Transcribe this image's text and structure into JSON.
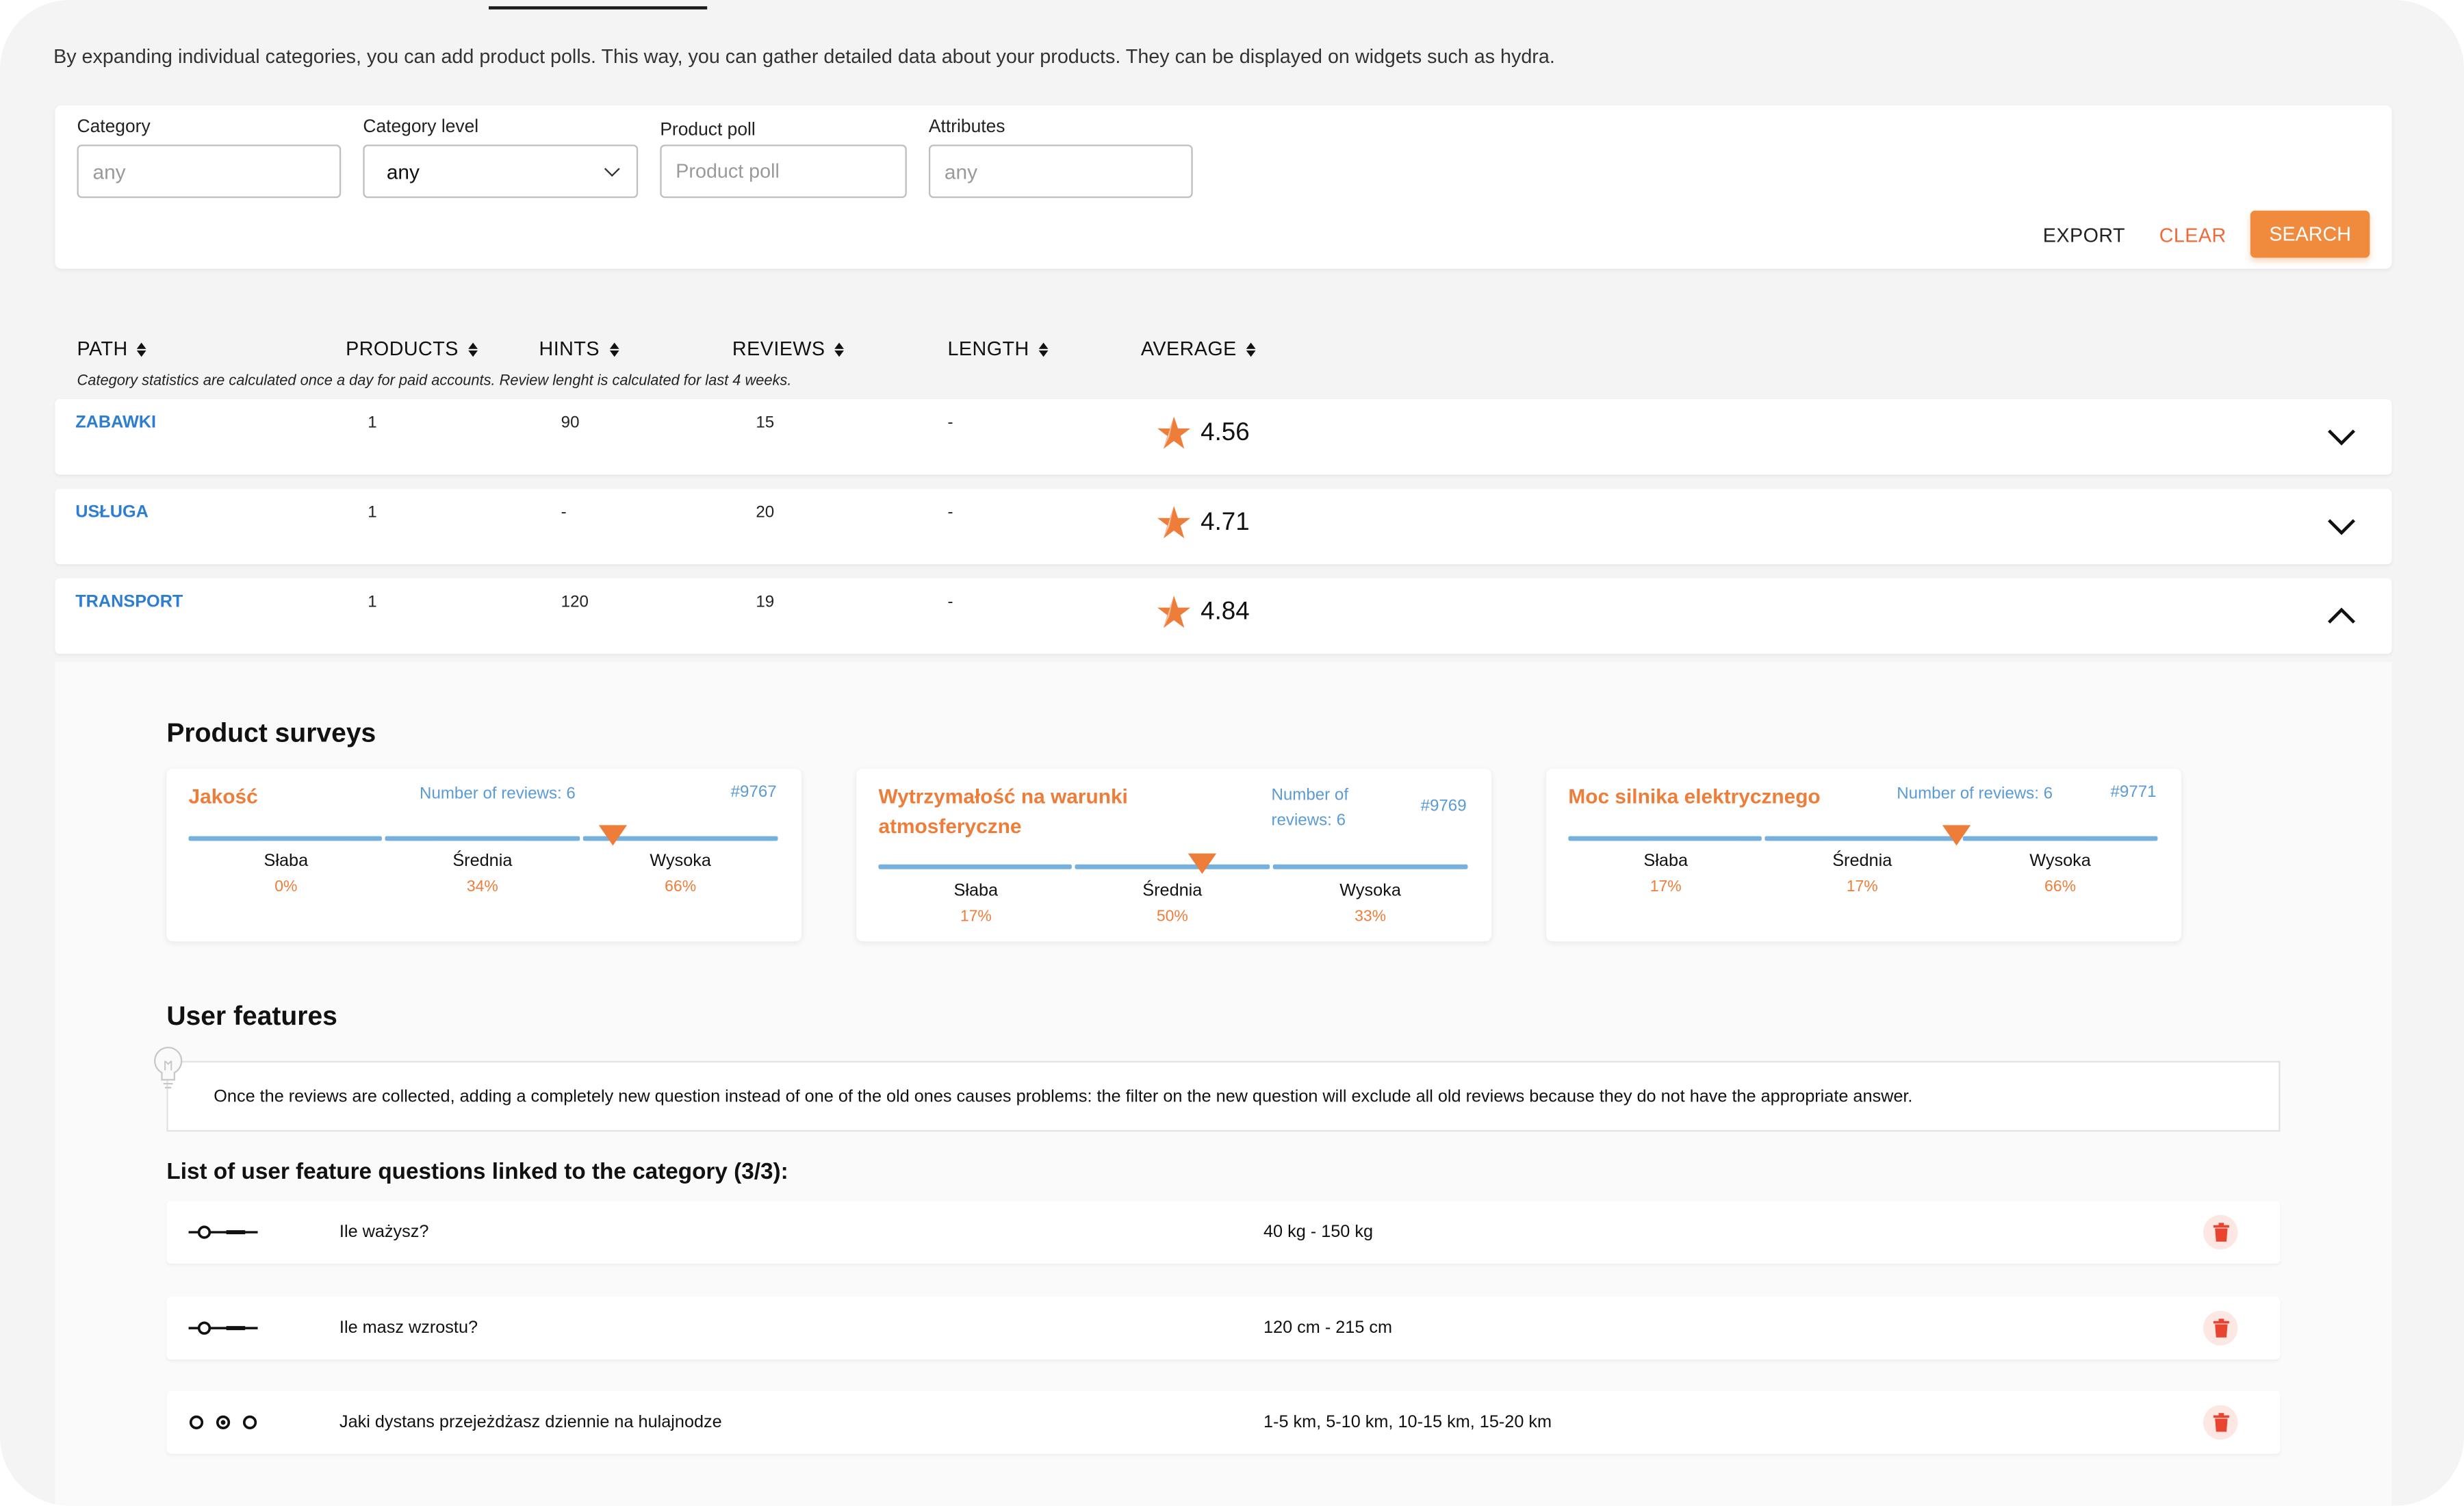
{
  "intro": "By expanding individual categories, you can add product polls. This way, you can gather detailed data about your products. They can be displayed on widgets such as hydra.",
  "filters": {
    "category": {
      "label": "Category",
      "placeholder": "any"
    },
    "category_level": {
      "label": "Category level",
      "value": "any"
    },
    "product_poll": {
      "label": "Product poll",
      "placeholder": "Product poll"
    },
    "attributes": {
      "label": "Attributes",
      "placeholder": "any"
    },
    "export_label": "EXPORT",
    "clear_label": "CLEAR",
    "search_label": "SEARCH"
  },
  "table": {
    "headers": [
      "PATH",
      "PRODUCTS",
      "HINTS",
      "REVIEWS",
      "LENGTH",
      "AVERAGE"
    ],
    "note": "Category statistics are calculated once a day for paid accounts. Review lenght is calculated for last 4 weeks.",
    "rows": [
      {
        "path": "ZABAWKI",
        "products": "1",
        "hints": "90",
        "reviews": "15",
        "length": "-",
        "average": "4.56",
        "expanded": false
      },
      {
        "path": "USŁUGA",
        "products": "1",
        "hints": "-",
        "reviews": "20",
        "length": "-",
        "average": "4.71",
        "expanded": false
      },
      {
        "path": "TRANSPORT",
        "products": "1",
        "hints": "120",
        "reviews": "19",
        "length": "-",
        "average": "4.84",
        "expanded": true
      }
    ]
  },
  "surveys_title": "Product surveys",
  "surveys": [
    {
      "title": "Jakość",
      "count": "Number of reviews: 6",
      "id": "#9767",
      "options": [
        {
          "label": "Słaba",
          "pct": "0%"
        },
        {
          "label": "Średnia",
          "pct": "34%"
        },
        {
          "label": "Wysoka",
          "pct": "66%"
        }
      ],
      "marker_value": 0.72
    },
    {
      "title": "Wytrzymałość na warunki atmosferyczne",
      "count": "Number of reviews: 6",
      "id": "#9769",
      "options": [
        {
          "label": "Słaba",
          "pct": "17%"
        },
        {
          "label": "Średnia",
          "pct": "50%"
        },
        {
          "label": "Wysoka",
          "pct": "33%"
        }
      ],
      "marker_value": 0.55
    },
    {
      "title": "Moc silnika elektrycznego",
      "count": "Number of reviews: 6",
      "id": "#9771",
      "options": [
        {
          "label": "Słaba",
          "pct": "17%"
        },
        {
          "label": "Średnia",
          "pct": "17%"
        },
        {
          "label": "Wysoka",
          "pct": "66%"
        }
      ],
      "marker_value": 0.66
    }
  ],
  "features_title": "User features",
  "tip": "Once the reviews are collected, adding a completely new question instead of one of the old ones causes problems: the filter on the new question will exclude all old reviews because they do not have the appropriate answer.",
  "list_title": "List of user feature questions linked to the category (3/3):",
  "features": [
    {
      "type": "slider",
      "question": "Ile ważysz?",
      "values": "40 kg - 150 kg"
    },
    {
      "type": "slider",
      "question": "Ile masz wzrostu?",
      "values": "120 cm - 215 cm"
    },
    {
      "type": "radio",
      "question": "Jaki dystans przejeżdżasz dziennie na hulajnodze",
      "values": "1-5 km, 5-10 km, 10-15 km, 15-20 km"
    }
  ],
  "colors": {
    "accent": "#ef7d3a",
    "link": "#2d7dd2",
    "bar": "#76b0dd",
    "delete": "#e8442f"
  }
}
